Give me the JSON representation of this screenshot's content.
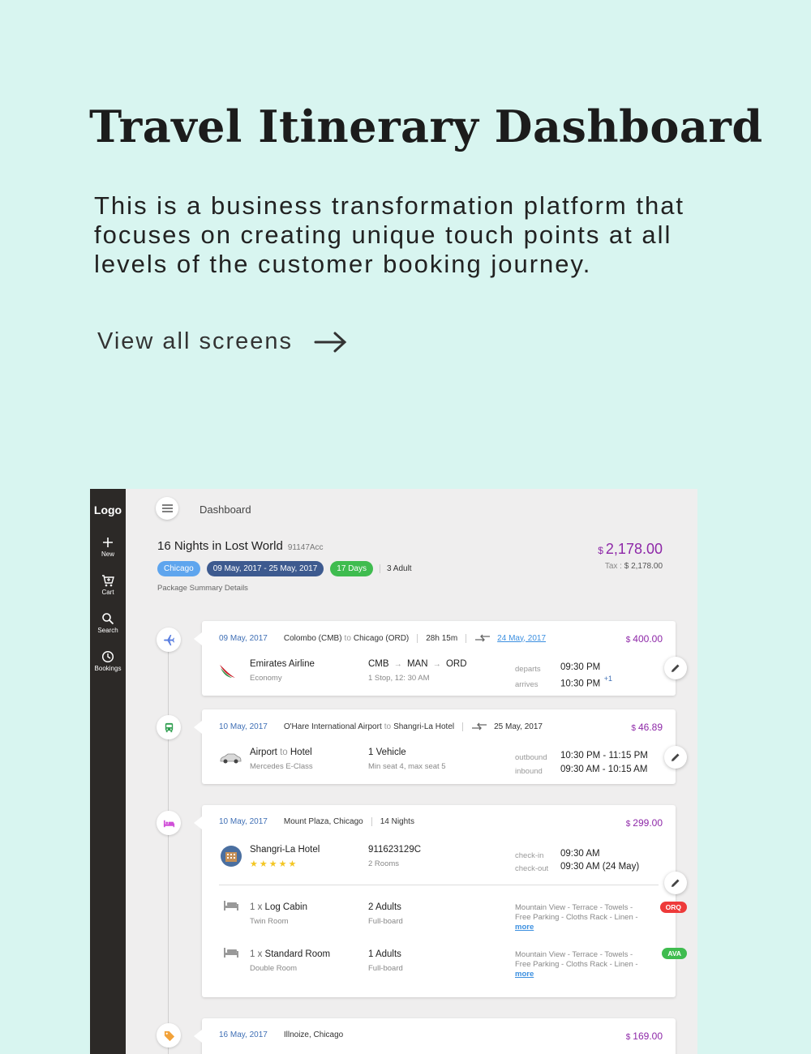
{
  "hero": {
    "title": "Travel Itinerary Dashboard",
    "description": "This is a business transformation platform that focuses on creating unique touch points at all levels of the customer booking journey.",
    "cta": "View all screens"
  },
  "sidebar": {
    "logo": "Logo",
    "items": [
      {
        "label": "New",
        "icon": "plus-icon"
      },
      {
        "label": "Cart",
        "icon": "cart-icon"
      },
      {
        "label": "Search",
        "icon": "search-icon"
      },
      {
        "label": "Bookings",
        "icon": "clock-icon"
      }
    ]
  },
  "header": {
    "breadcrumb": "Dashboard"
  },
  "package": {
    "title": "16 Nights in Lost World",
    "code": "91147Acc",
    "city": "Chicago",
    "dates": "09 May, 2017 - 25 May, 2017",
    "days": "17 Days",
    "adults": "3 Adult",
    "summary": "Package Summary Details",
    "currency": "$",
    "total": "2,178.00",
    "tax_label": "Tax :",
    "tax_value": "$ 2,178.00"
  },
  "flight": {
    "date_day": "09",
    "date_rest": "May, 2017",
    "from": "Colombo (CMB)",
    "to_word": "to",
    "to": "Chicago (ORD)",
    "duration": "28h 15m",
    "return_date": "24 May, 2017",
    "currency": "$",
    "price": "400.00",
    "airline": "Emirates Airline",
    "cabin": "Economy",
    "route_a": "CMB",
    "route_b": "MAN",
    "route_c": "ORD",
    "stops": "1 Stop, 12: 30 AM",
    "departs_label": "departs",
    "departs": "09:30 PM",
    "arrives_label": "arrives",
    "arrives": "10:30 PM",
    "arrives_extra": "+1"
  },
  "transfer": {
    "date_day": "10",
    "date_rest": "May, 2017",
    "from": "O'Hare International Airport",
    "to_word": "to",
    "to": "Shangri-La Hotel",
    "return_date": "25 May, 2017",
    "currency": "$",
    "price": "46.89",
    "title_a": "Airport",
    "title_to": "to",
    "title_b": "Hotel",
    "vehicle": "Mercedes E-Class",
    "count": "1 Vehicle",
    "seats": "Min seat 4, max seat 5",
    "outbound_label": "outbound",
    "outbound": "10:30 PM - 11:15 PM",
    "inbound_label": "inbound",
    "inbound": "09:30 AM - 10:15 AM"
  },
  "hotel": {
    "date_day": "10",
    "date_rest": "May, 2017",
    "location": "Mount Plaza, Chicago",
    "nights": "14 Nights",
    "currency": "$",
    "price": "299.00",
    "name": "Shangri-La Hotel",
    "stars": "★★★★★",
    "ref": "911623129C",
    "rooms": "2 Rooms",
    "checkin_label": "check-in",
    "checkin": "09:30 AM",
    "checkout_label": "check-out",
    "checkout": "09:30 AM (24 May)",
    "room_list": [
      {
        "qty": "1 x",
        "name": "Log Cabin",
        "type": "Twin Room",
        "adults": "2 Adults",
        "board": "Full-board",
        "amenities_1": "Mountain View - Terrace - Towels -",
        "amenities_2": "Free Parking - Cloths Rack - Linen -",
        "more": "more",
        "badge": "ORQ",
        "badge_color": "#ee3a3a"
      },
      {
        "qty": "1 x",
        "name": "Standard Room",
        "type": "Double Room",
        "adults": "1 Adults",
        "board": "Full-board",
        "amenities_1": "Mountain View - Terrace - Towels -",
        "amenities_2": "Free Parking - Cloths Rack - Linen -",
        "more": "more",
        "badge": "AVA",
        "badge_color": "#3fbc4f"
      }
    ]
  },
  "activity": {
    "date_day": "16",
    "date_rest": "May, 2017",
    "location": "Illnoize, Chicago",
    "currency": "$",
    "price": "169.00"
  },
  "colors": {
    "background": "#d8f5f0",
    "sidebar": "#2c2927",
    "price_purple": "#8e28a8",
    "date_blue": "#3f6fb5"
  }
}
